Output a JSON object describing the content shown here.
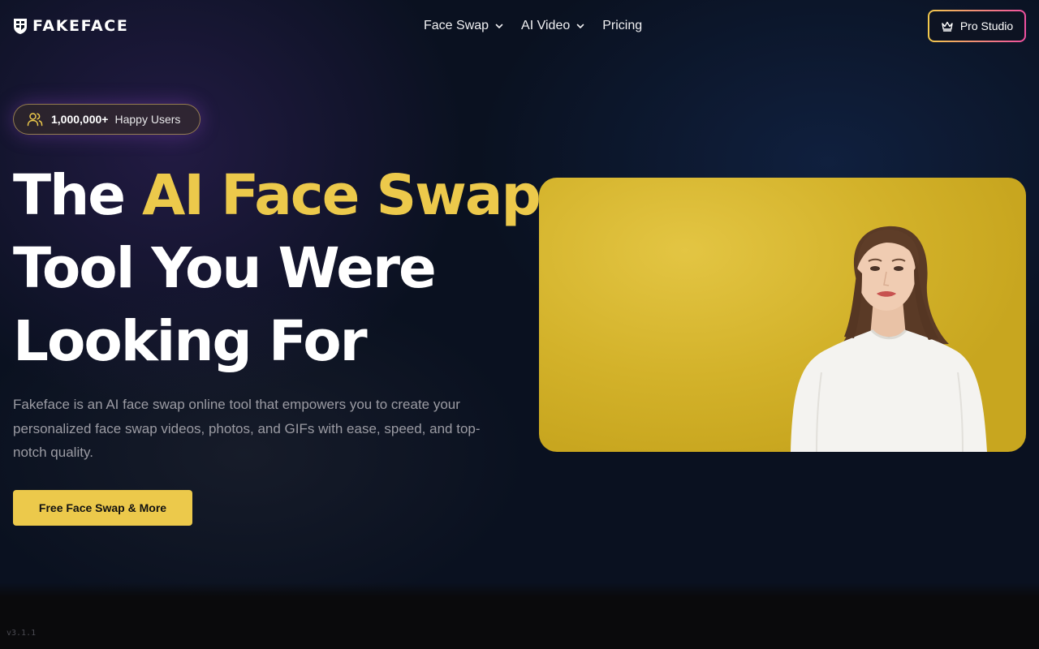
{
  "brand": {
    "name": "FAKEFACE"
  },
  "nav": {
    "items": [
      {
        "label": "Face Swap",
        "dropdown": true
      },
      {
        "label": "AI Video",
        "dropdown": true
      },
      {
        "label": "Pricing",
        "dropdown": false
      }
    ]
  },
  "pro_button": {
    "label": "Pro Studio",
    "icon": "crown-icon"
  },
  "badge": {
    "count": "1,000,000+",
    "label": "Happy Users",
    "icon": "users-icon"
  },
  "hero": {
    "headline_prefix": "The ",
    "headline_accent": "AI Face Swap",
    "headline_line2": "Tool You Were",
    "headline_line3": "Looking For",
    "description": "Fakeface is an AI face swap online tool that empowers you to create your personalized face swap videos, photos, and GIFs with ease, speed, and top-notch quality.",
    "cta_label": "Free Face Swap & More"
  },
  "version": "v3.1.1",
  "colors": {
    "background": "#0a1120",
    "accent": "#ecc94b",
    "pro_border_start": "#f2c94c",
    "pro_border_end": "#ef4fa0",
    "hero_image_bg": "#d9b931"
  }
}
